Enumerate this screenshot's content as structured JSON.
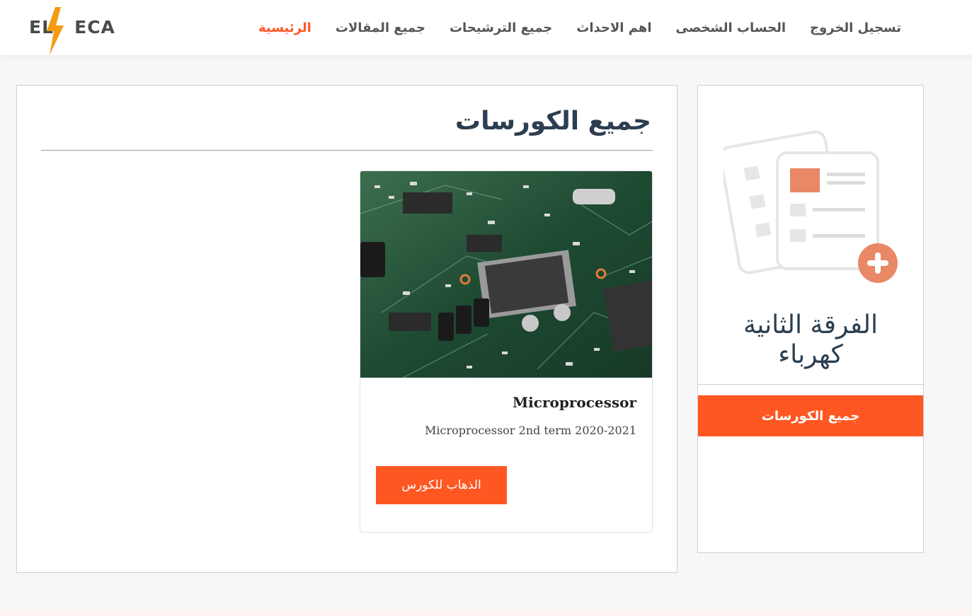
{
  "brand": {
    "logo_text": "EL ECA",
    "accent": "#ff5722",
    "bolt_color": "#f39c12"
  },
  "nav": {
    "items": [
      {
        "label": "الرئيسية",
        "active": true
      },
      {
        "label": "جميع المقالات",
        "active": false
      },
      {
        "label": "جميع الترشيحات",
        "active": false
      },
      {
        "label": "اهم الاحداث",
        "active": false
      },
      {
        "label": "الحساب الشخصى",
        "active": false
      },
      {
        "label": "تسجيل الخروج",
        "active": false
      }
    ]
  },
  "main": {
    "title": "جميع الكورسات",
    "courses": [
      {
        "image_icon": "circuit-board-image",
        "title": "Microprocessor",
        "description": "Microprocessor 2nd term 2020-2021",
        "button_label": "الذهاب للكورس"
      }
    ]
  },
  "sidebar": {
    "illustration_icon": "add-document-icon",
    "title_line1": "الفرقة الثانية",
    "title_line2": "كهرباء",
    "button_label": "جميع الكورسات"
  }
}
